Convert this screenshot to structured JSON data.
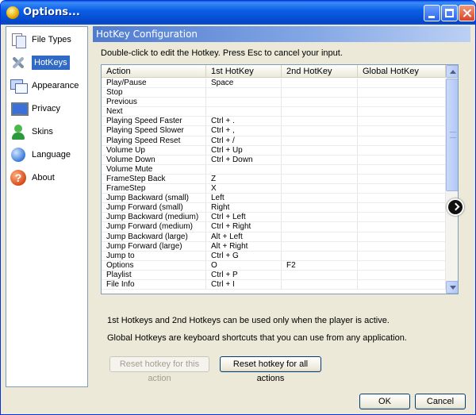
{
  "window": {
    "title": "Options..."
  },
  "sidebar": {
    "items": [
      {
        "label": "File Types",
        "icon": "file-types-icon",
        "active": false
      },
      {
        "label": "HotKeys",
        "icon": "hotkeys-icon",
        "active": true
      },
      {
        "label": "Appearance",
        "icon": "appearance-icon",
        "active": false
      },
      {
        "label": "Privacy",
        "icon": "privacy-icon",
        "active": false
      },
      {
        "label": "Skins",
        "icon": "skins-icon",
        "active": false
      },
      {
        "label": "Language",
        "icon": "language-icon",
        "active": false
      },
      {
        "label": "About",
        "icon": "about-icon",
        "active": false
      }
    ]
  },
  "panel": {
    "title": "HotKey Configuration",
    "instructions": "Double-click to edit the Hotkey. Press Esc to cancel your input.",
    "columns": [
      "Action",
      "1st HotKey",
      "2nd HotKey",
      "Global HotKey"
    ],
    "rows": [
      [
        "Play/Pause",
        "Space",
        "",
        ""
      ],
      [
        "Stop",
        "",
        "",
        ""
      ],
      [
        "Previous",
        "",
        "",
        ""
      ],
      [
        "Next",
        "",
        "",
        ""
      ],
      [
        "Playing Speed Faster",
        "Ctrl + .",
        "",
        ""
      ],
      [
        "Playing Speed Slower",
        "Ctrl + ,",
        "",
        ""
      ],
      [
        "Playing Speed Reset",
        "Ctrl + /",
        "",
        ""
      ],
      [
        "Volume Up",
        "Ctrl + Up",
        "",
        ""
      ],
      [
        "Volume Down",
        "Ctrl + Down",
        "",
        ""
      ],
      [
        "Volume Mute",
        "",
        "",
        ""
      ],
      [
        "FrameStep Back",
        "Z",
        "",
        ""
      ],
      [
        "FrameStep",
        "X",
        "",
        ""
      ],
      [
        "Jump Backward (small)",
        "Left",
        "",
        ""
      ],
      [
        "Jump Forward (small)",
        "Right",
        "",
        ""
      ],
      [
        "Jump Backward (medium)",
        "Ctrl + Left",
        "",
        ""
      ],
      [
        "Jump Forward (medium)",
        "Ctrl + Right",
        "",
        ""
      ],
      [
        "Jump Backward (large)",
        "Alt + Left",
        "",
        ""
      ],
      [
        "Jump Forward (large)",
        "Alt + Right",
        "",
        ""
      ],
      [
        "Jump to",
        "Ctrl + G",
        "",
        ""
      ],
      [
        "Options",
        "O",
        "F2",
        ""
      ],
      [
        "Playlist",
        "Ctrl + P",
        "",
        ""
      ],
      [
        "File Info",
        "Ctrl + I",
        "",
        ""
      ]
    ],
    "note1": "1st Hotkeys and 2nd Hotkeys can be used only when the player is active.",
    "note2": "Global Hotkeys are keyboard shortcuts that you can use from any application.",
    "reset_one_label": "Reset hotkey for this action",
    "reset_all_label": "Reset hotkey for all actions"
  },
  "footer": {
    "ok_label": "OK",
    "cancel_label": "Cancel"
  },
  "colors": {
    "accent": "#316ac5",
    "titlebar": "#0a5fe6",
    "panel_header": "#4f7bd0"
  }
}
